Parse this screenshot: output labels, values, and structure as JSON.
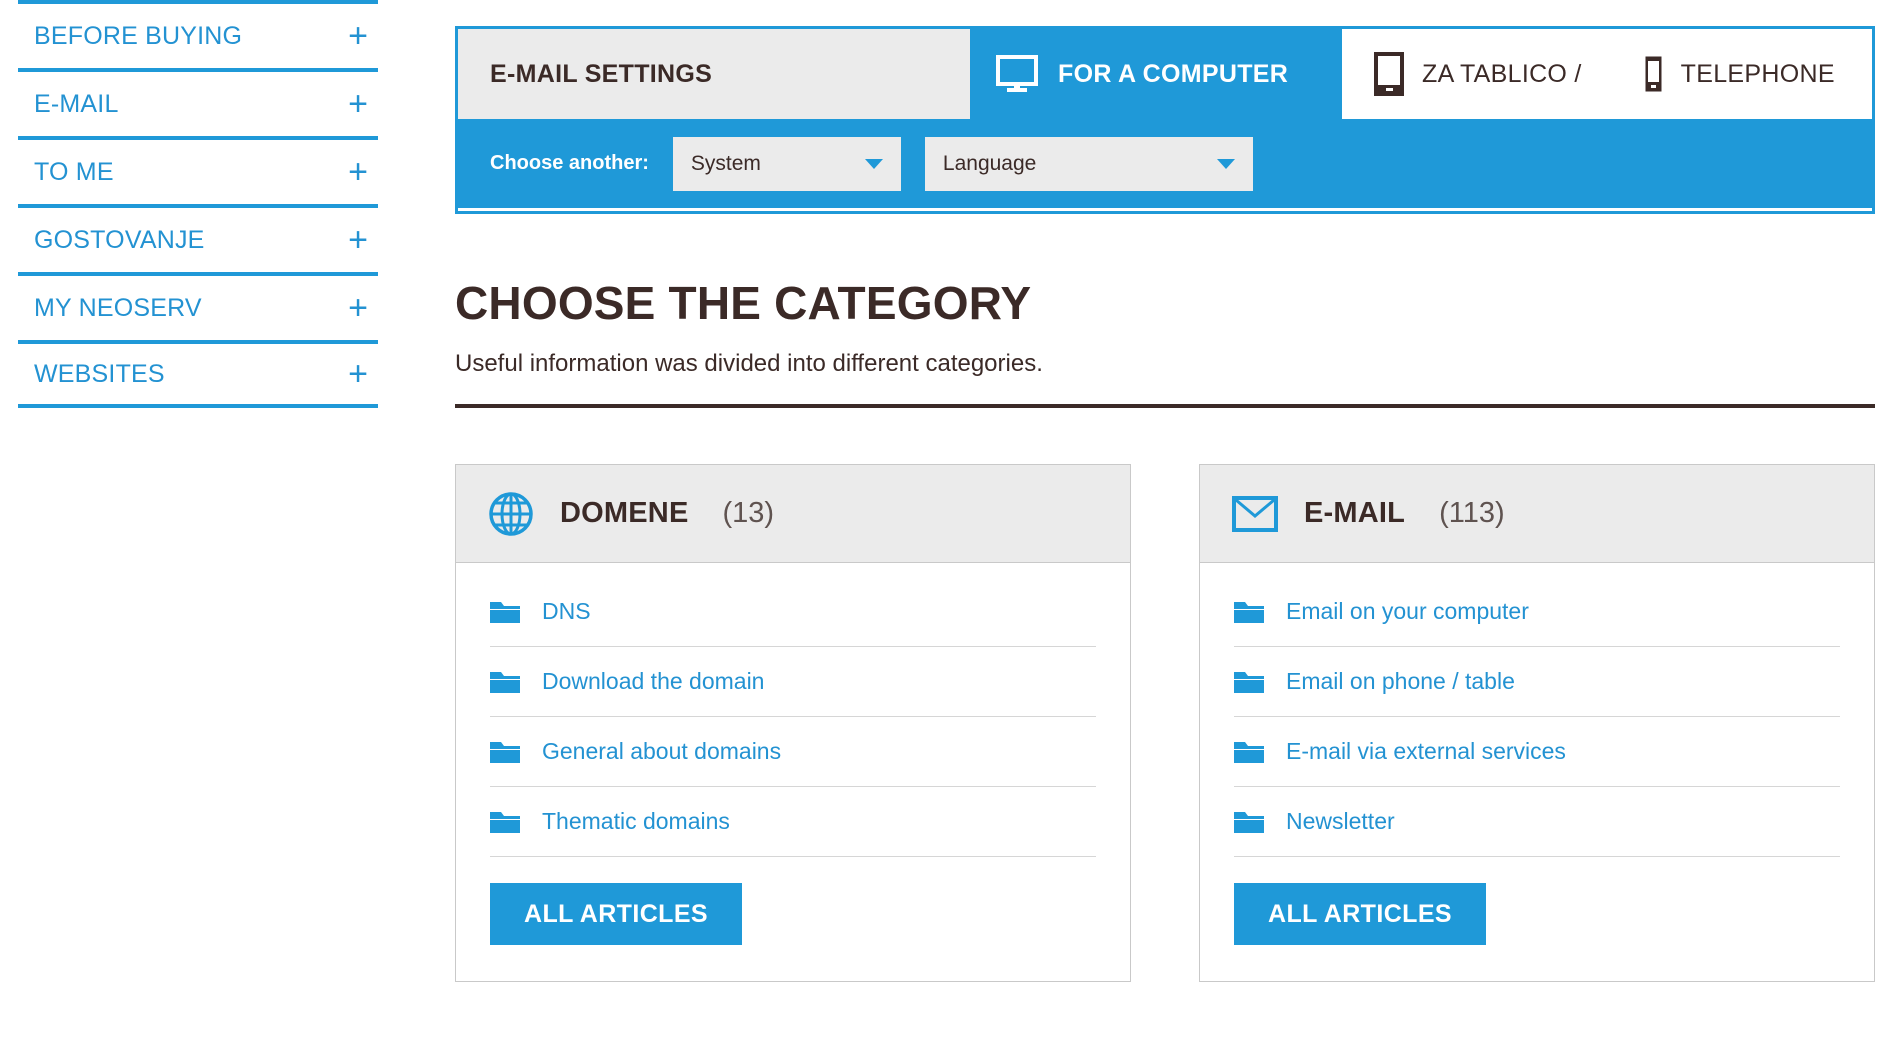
{
  "colors": {
    "accent_blue": "#1f99d8",
    "link_blue": "#2392d2",
    "dark_text": "#3b2a27",
    "panel_gray": "#ebebeb",
    "border_gray": "#c9c9c9"
  },
  "sidebar": {
    "items": [
      {
        "label": "BEFORE BUYING",
        "toggle": "+"
      },
      {
        "label": "E-MAIL",
        "toggle": "+"
      },
      {
        "label": "TO ME",
        "toggle": "+"
      },
      {
        "label": "GOSTOVANJE",
        "toggle": "+"
      },
      {
        "label": "MY NEOSERV",
        "toggle": "+"
      },
      {
        "label": "WEBSITES",
        "toggle": "+"
      }
    ]
  },
  "tabs": {
    "title": "E-MAIL SETTINGS",
    "computer": {
      "label": "FOR A COMPUTER",
      "icon": "monitor-icon",
      "active": true
    },
    "tablet": {
      "label": "ZA TABLICO /",
      "icon": "tablet-icon",
      "active": false
    },
    "telephone": {
      "label": "TELEPHONE",
      "icon": "phone-icon",
      "active": false
    }
  },
  "chooser": {
    "label": "Choose another:",
    "system": {
      "value": "System",
      "caret": "chevron-down-icon"
    },
    "language": {
      "value": "Language",
      "caret": "chevron-down-icon"
    }
  },
  "heading": {
    "title": "CHOOSE THE CATEGORY",
    "subtitle": "Useful information was divided into different categories."
  },
  "cards": [
    {
      "icon": "globe-icon",
      "title": "DOMENE",
      "count": "(13)",
      "items": [
        {
          "label": "DNS",
          "icon": "folder-icon"
        },
        {
          "label": "Download the domain",
          "icon": "folder-icon"
        },
        {
          "label": "General about domains",
          "icon": "folder-icon"
        },
        {
          "label": "Thematic domains",
          "icon": "folder-icon"
        }
      ],
      "button": "ALL ARTICLES"
    },
    {
      "icon": "envelope-icon",
      "title": "E-MAIL",
      "count": "(113)",
      "items": [
        {
          "label": "Email on your computer",
          "icon": "folder-icon"
        },
        {
          "label": "Email on phone / table",
          "icon": "folder-icon"
        },
        {
          "label": "E-mail via external services",
          "icon": "folder-icon"
        },
        {
          "label": "Newsletter",
          "icon": "folder-icon"
        }
      ],
      "button": "ALL ARTICLES"
    }
  ]
}
